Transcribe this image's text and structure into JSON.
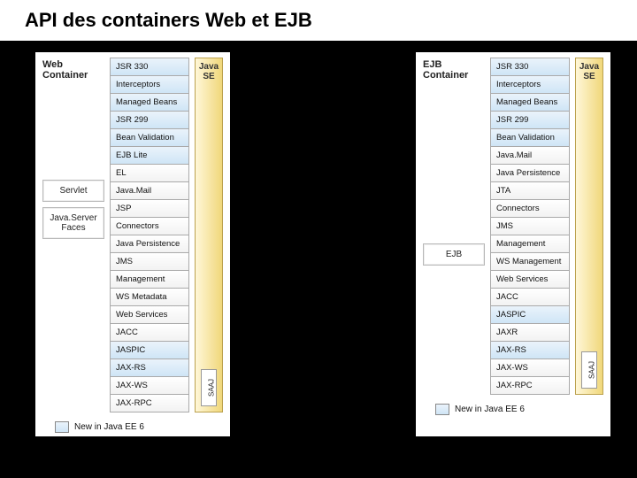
{
  "title": "API des containers Web et EJB",
  "legend": "New in Java EE 6",
  "javase_label": "Java SE",
  "saaj_label": "SAAJ",
  "left": {
    "header": "Web\nContainer",
    "boxes": [
      "Servlet",
      "Java.Server\nFaces"
    ],
    "apis": [
      {
        "t": "JSR 330",
        "n": true
      },
      {
        "t": "Interceptors",
        "n": true
      },
      {
        "t": "Managed Beans",
        "n": true
      },
      {
        "t": "JSR 299",
        "n": true
      },
      {
        "t": "Bean Validation",
        "n": true
      },
      {
        "t": "EJB Lite",
        "n": true
      },
      {
        "t": "EL",
        "n": false
      },
      {
        "t": "Java.Mail",
        "n": false
      },
      {
        "t": "JSP",
        "n": false
      },
      {
        "t": "Connectors",
        "n": false
      },
      {
        "t": "Java Persistence",
        "n": false
      },
      {
        "t": "JMS",
        "n": false
      },
      {
        "t": "Management",
        "n": false
      },
      {
        "t": "WS Metadata",
        "n": false
      },
      {
        "t": "Web Services",
        "n": false
      },
      {
        "t": "JACC",
        "n": false
      },
      {
        "t": "JASPIC",
        "n": true
      },
      {
        "t": "JAX-RS",
        "n": true
      },
      {
        "t": "JAX-WS",
        "n": false
      },
      {
        "t": "JAX-RPC",
        "n": false
      }
    ]
  },
  "right": {
    "header": "EJB\nContainer",
    "boxes": [
      "EJB"
    ],
    "apis": [
      {
        "t": "JSR 330",
        "n": true
      },
      {
        "t": "Interceptors",
        "n": true
      },
      {
        "t": "Managed Beans",
        "n": true
      },
      {
        "t": "JSR 299",
        "n": true
      },
      {
        "t": "Bean Validation",
        "n": true
      },
      {
        "t": "Java.Mail",
        "n": false
      },
      {
        "t": "Java Persistence",
        "n": false
      },
      {
        "t": "JTA",
        "n": false
      },
      {
        "t": "Connectors",
        "n": false
      },
      {
        "t": "JMS",
        "n": false
      },
      {
        "t": "Management",
        "n": false
      },
      {
        "t": "WS Management",
        "n": false
      },
      {
        "t": "Web Services",
        "n": false
      },
      {
        "t": "JACC",
        "n": false
      },
      {
        "t": "JASPIC",
        "n": true
      },
      {
        "t": "JAXR",
        "n": false
      },
      {
        "t": "JAX-RS",
        "n": true
      },
      {
        "t": "JAX-WS",
        "n": false
      },
      {
        "t": "JAX-RPC",
        "n": false
      }
    ]
  }
}
